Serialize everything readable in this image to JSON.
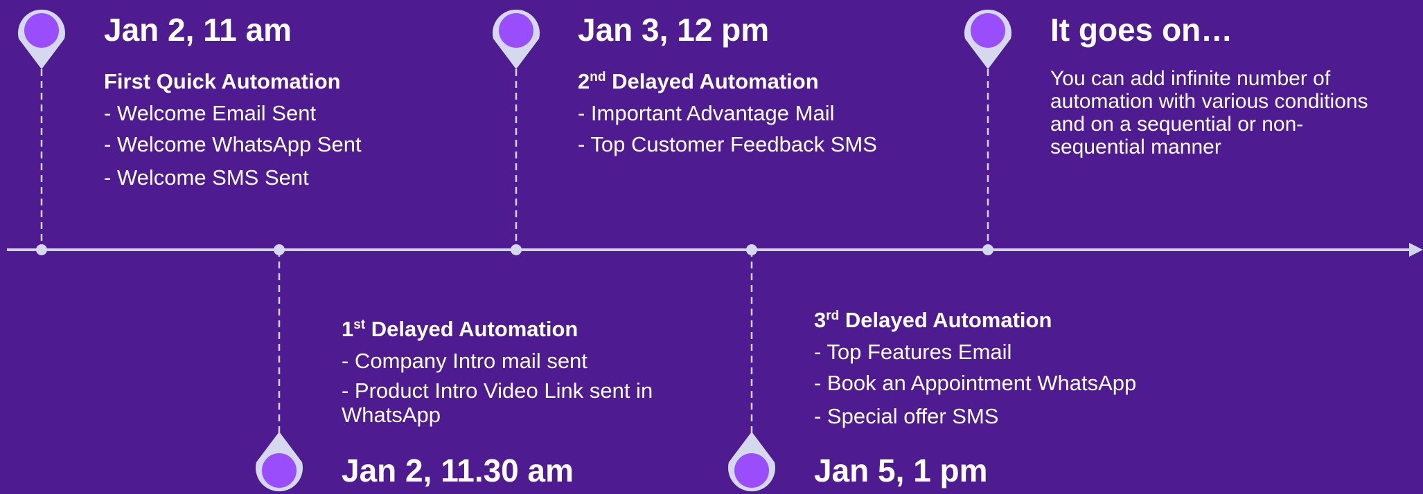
{
  "colors": {
    "background": "#4f1b91",
    "axis": "#cfd5ea",
    "pin_outer": "#d4d9ee",
    "pin_inner": "#9a4dfb",
    "text": "#ffffff"
  },
  "milestones": [
    {
      "date": "Jan 2, 11 am",
      "heading": "First Quick Automation",
      "items": [
        "- Welcome Email Sent",
        "- Welcome WhatsApp Sent",
        "- Welcome SMS Sent"
      ]
    },
    {
      "date": "Jan 2, 11.30 am",
      "heading": {
        "ord_num": "1",
        "ord_sup": "st",
        "rest": " Delayed Automation"
      },
      "items": [
        "- Company Intro mail sent",
        "- Product Intro Video Link sent in WhatsApp"
      ]
    },
    {
      "date": "Jan 3, 12 pm",
      "heading": {
        "ord_num": "2",
        "ord_sup": "nd",
        "rest": " Delayed Automation"
      },
      "items": [
        "- Important Advantage Mail",
        "- Top Customer Feedback SMS"
      ]
    },
    {
      "date": "Jan 5, 1 pm",
      "heading": {
        "ord_num": "3",
        "ord_sup": "rd",
        "rest": " Delayed Automation"
      },
      "items": [
        "- Top Features Email",
        "- Book an Appointment WhatsApp",
        "- Special offer SMS"
      ]
    },
    {
      "date": "It goes on…",
      "description": "You can add infinite number of automation with various conditions and on a sequential or non-sequential manner"
    }
  ]
}
